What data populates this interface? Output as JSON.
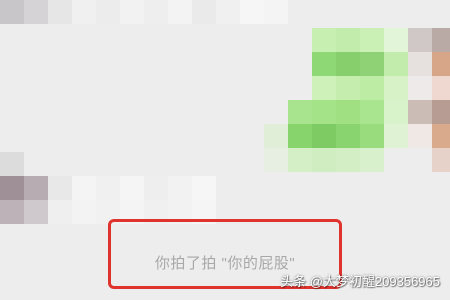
{
  "chat": {
    "system_notice": "你拍了拍 \"你的屁股\""
  },
  "watermark": {
    "text": "头条 @大梦初醒209356965"
  },
  "colors": {
    "background": "#ededed",
    "highlight_border": "#e0332e",
    "notice_text": "#a8a8a8"
  }
}
